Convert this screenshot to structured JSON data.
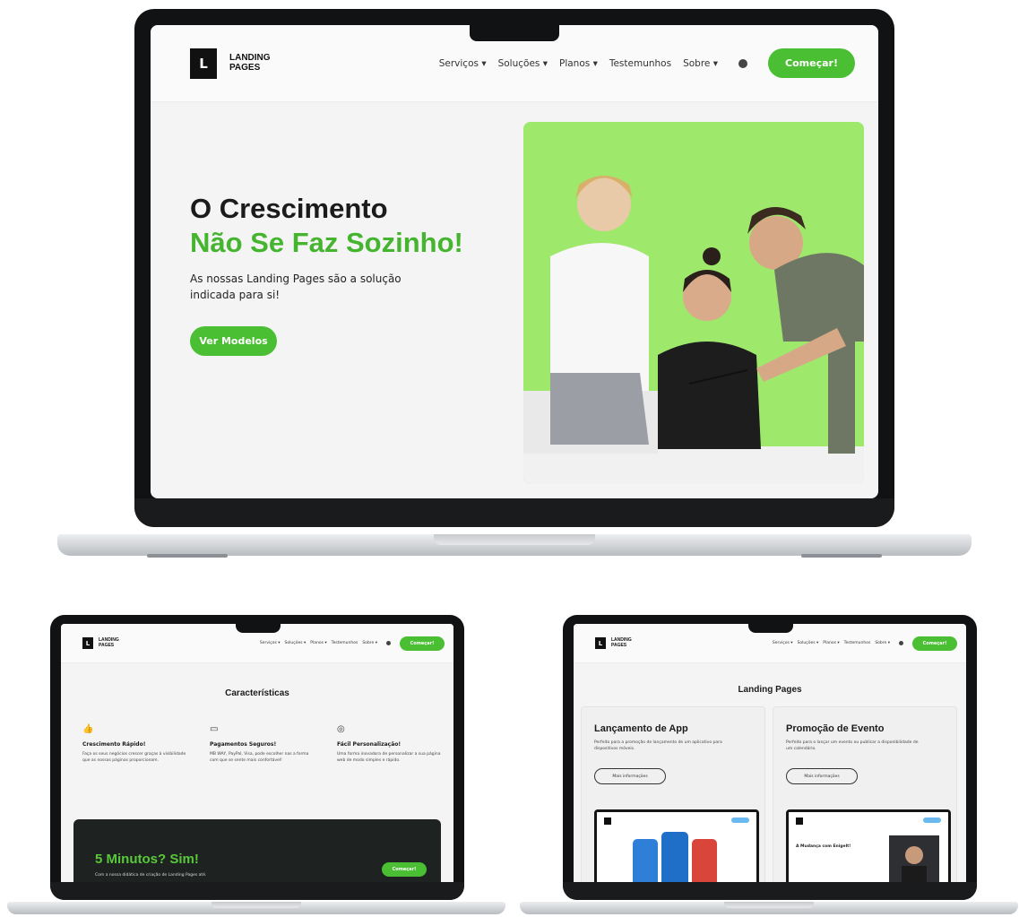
{
  "brand": {
    "logo_letter": "L",
    "logo_line1": "LANDING",
    "logo_line2": "PAGES"
  },
  "nav": {
    "items": [
      "Serviços ▾",
      "Soluções ▾",
      "Planos ▾",
      "Testemunhos",
      "Sobre ▾"
    ],
    "globe_icon": "globe-icon",
    "cta": "Começar!"
  },
  "hero": {
    "line1": "O Crescimento",
    "line2": "Não Se Faz Sozinho!",
    "subtitle": "As nossas Landing Pages são a solução indicada para si!",
    "button": "Ver Modelos"
  },
  "features": {
    "title": "Características",
    "items": [
      {
        "icon": "thumbs-up-icon",
        "title": "Crescimento Rápido!",
        "desc": "Faça os seus negócios crescer graças à visibilidade que as nossas páginas proporcionam."
      },
      {
        "icon": "credit-card-icon",
        "title": "Pagamentos Seguros!",
        "desc": "MB WAY, PayPal, Visa, pode escolher nas a forma com que se sente mais confortável!"
      },
      {
        "icon": "palette-icon",
        "title": "Fácil Personalização!",
        "desc": "Uma forma inovadora de personalizar a sua página web de modo simples e rápido."
      }
    ],
    "banner_title": "5 Minutos? Sim!",
    "banner_desc": "Com a nossa didática de criação de Landing Pages até.",
    "banner_button": "Começar!"
  },
  "landing_pages": {
    "title": "Landing Pages",
    "cards": [
      {
        "title": "Lançamento de App",
        "desc": "Perfeito para a promoção de lançamento de um aplicativo para dispositivos móveis.",
        "button": "Mais informações"
      },
      {
        "title": "Promoção de Evento",
        "desc": "Perfeito para o lançar um evento ou publicar a disponibilidade de um calendário.",
        "button": "Mais informações"
      }
    ],
    "preview_text": "A Mudança com Enigelt!"
  },
  "colors": {
    "accent": "#4bbf33",
    "hero_bg": "#9ee86c",
    "dark": "#1e2220"
  }
}
